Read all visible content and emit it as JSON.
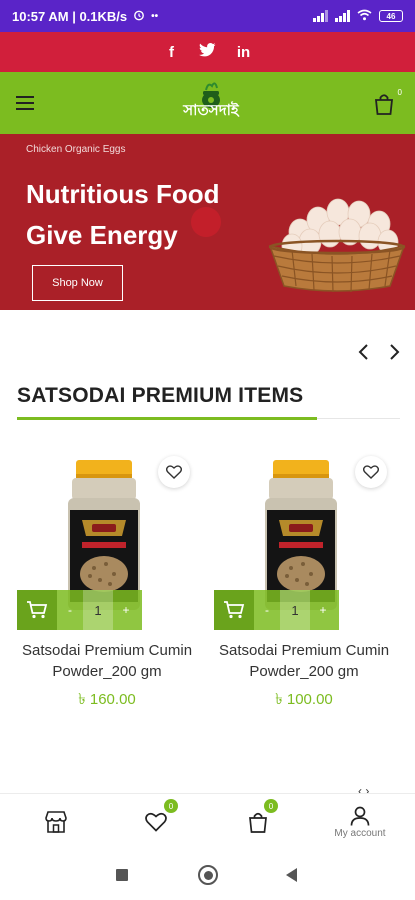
{
  "status_bar": {
    "time_speed": "10:57 AM | 0.1KB/s",
    "battery": "46"
  },
  "social": {
    "facebook": "f",
    "twitter": "twitter-icon",
    "linkedin": "in"
  },
  "header": {
    "logo_text": "সাতসদাই",
    "cart_count": "0"
  },
  "banner": {
    "subtitle": "Chicken Organic Eggs",
    "title": "Nutritious Food Give Energy",
    "button": "Shop Now"
  },
  "section": {
    "title": "SATSODAI PREMIUM ITEMS",
    "prev": "‹",
    "next": "›"
  },
  "products": [
    {
      "name": "Satsodai Premium Cumin Powder_200 gm",
      "price": "৳ 160.00",
      "qty": "1",
      "minus": "-",
      "plus": "+"
    },
    {
      "name": "Satsodai Premium Cumin Powder_200 gm",
      "price": "৳ 100.00",
      "qty": "1",
      "minus": "-",
      "plus": "+"
    }
  ],
  "bottom_nav": {
    "wishlist_count": "0",
    "cart_count": "0",
    "account_label": "My account"
  },
  "colors": {
    "accent_green": "#7cbc20",
    "social_red": "#d11f3b",
    "banner_red": "#aa2028",
    "status_purple": "#5a24c8"
  }
}
